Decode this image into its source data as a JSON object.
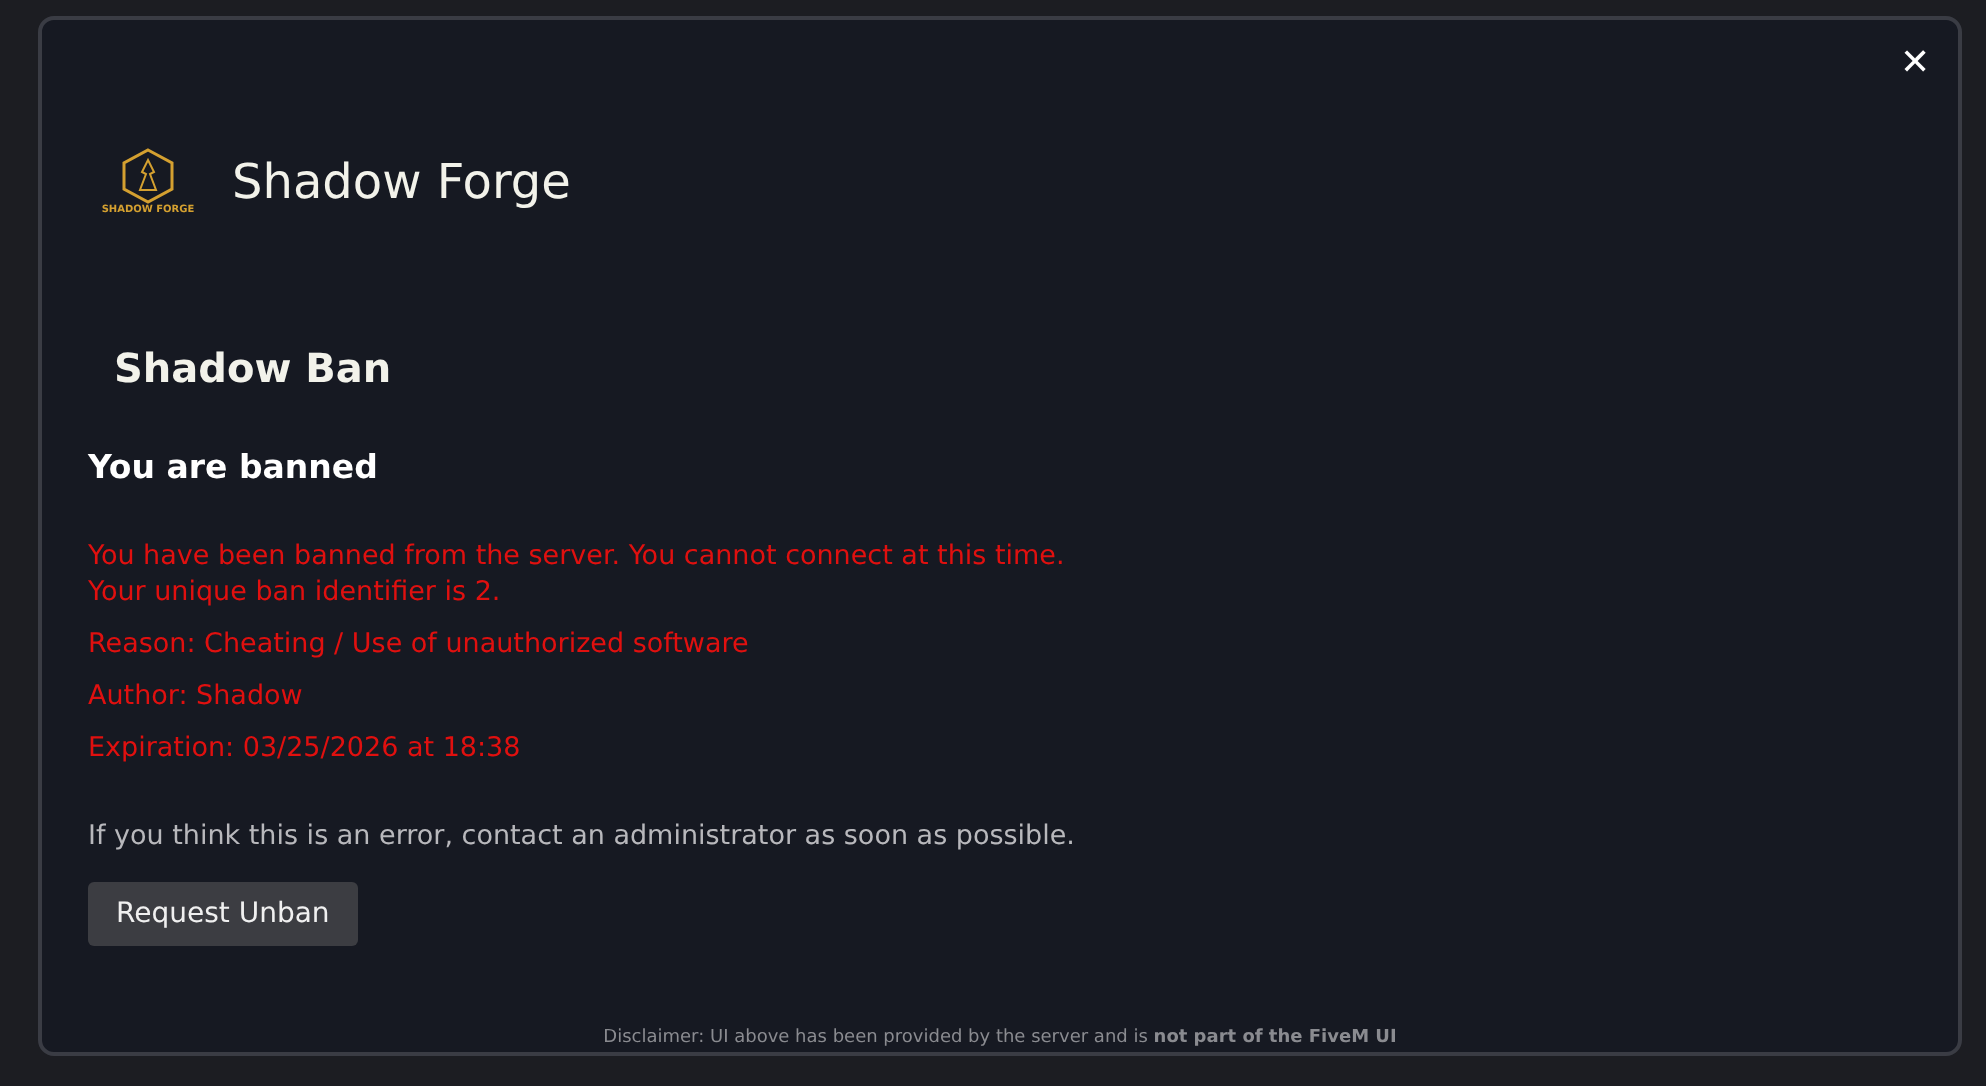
{
  "dialog": {
    "close": "✕",
    "logo_text": "SHADOW FORGE",
    "title": "Shadow Forge"
  },
  "ban": {
    "heading": "Shadow Ban",
    "subheading": "You are banned",
    "messages": [
      "You have been banned from the server. You cannot connect at this time.\nYour unique ban identifier is 2.",
      "Reason: Cheating / Use of unauthorized software",
      "Author: Shadow",
      "Expiration: 03/25/2026 at 18:38"
    ],
    "advice": "If you think this is an error, contact an administrator as soon as possible.",
    "button": "Request Unban"
  },
  "disclaimer": "Disclaimer: UI above has been provided by the server and is **not part of the FiveM UI**"
}
